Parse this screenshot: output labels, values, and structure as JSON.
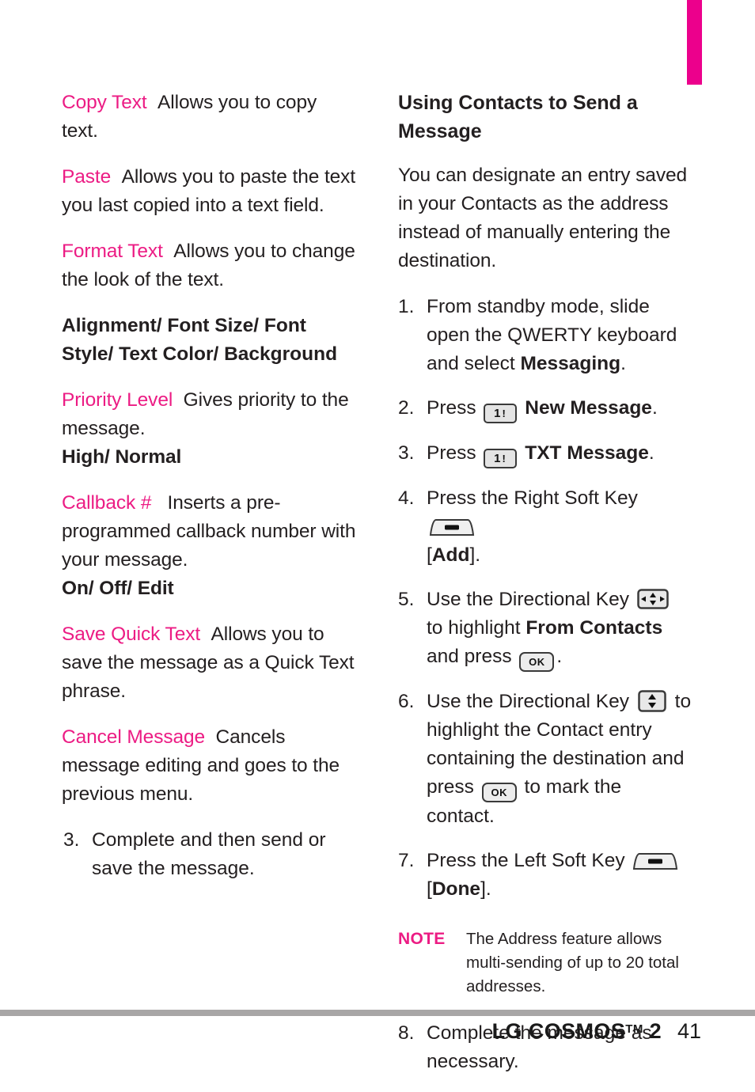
{
  "page": {
    "number": "41",
    "footer_brand": "LG COSMOS",
    "footer_tm": "TM",
    "footer_model": "2",
    "accent_color": "#EC1C84",
    "tab_color": "#EC008C"
  },
  "left_column": {
    "entries": [
      {
        "term": "Copy Text",
        "description": "Allows you to copy text."
      },
      {
        "term": "Paste",
        "description": "Allows you to paste the text you last copied into a text field."
      },
      {
        "term": "Format Text",
        "description": "Allows you to change the look of the text."
      }
    ],
    "format_options": "Alignment/ Font Size/ Font Style/ Text Color/ Background",
    "priority": {
      "term": "Priority Level",
      "description": "Gives priority to the message.",
      "options": "High/ Normal"
    },
    "callback": {
      "term": "Callback #",
      "description": "Inserts a pre-programmed callback number with your message.",
      "options": "On/ Off/ Edit"
    },
    "save_quick_text": {
      "term": "Save Quick Text",
      "description": "Allows you to save the message as a Quick Text phrase."
    },
    "cancel_message": {
      "term": "Cancel Message",
      "description": "Cancels message editing and goes to the previous menu."
    },
    "final_step": {
      "number": "3.",
      "text": "Complete and then send or save the message."
    }
  },
  "right_column": {
    "heading": "Using Contacts to Send a Message",
    "intro": "You can designate an entry saved in your Contacts as the address instead of manually entering the destination.",
    "steps": [
      {
        "number": "1.",
        "text_before": "From standby mode, slide open the QWERTY keyboard and select ",
        "bold": "Messaging",
        "text_after": "."
      },
      {
        "number": "2.",
        "text_before": "Press ",
        "key": "key-1-exclamation",
        "key_label": "1",
        "key_sublabel": "!",
        "bold": "New Message",
        "text_after": "."
      },
      {
        "number": "3.",
        "text_before": "Press ",
        "key": "key-1-exclamation",
        "key_label": "1",
        "key_sublabel": "!",
        "bold": "TXT Message",
        "text_after": "."
      },
      {
        "number": "4.",
        "text_before": "Press the Right Soft Key ",
        "key": "soft-key-icon",
        "text_mid": "[",
        "bold": "Add",
        "text_after": "]."
      },
      {
        "number": "5.",
        "text_before": "Use the Directional Key ",
        "key": "directional-key-4way-icon",
        "text_mid": " to highlight ",
        "bold": "From Contacts",
        "text_after": " and press ",
        "key2": "ok-key-icon",
        "key2_label": "OK",
        "text_end": "."
      },
      {
        "number": "6.",
        "text_before": "Use the Directional Key ",
        "key": "directional-key-updown-icon",
        "text_mid": " to highlight the Contact entry containing the destination and press ",
        "key2": "ok-key-icon",
        "key2_label": "OK",
        "text_end": " to mark the contact."
      },
      {
        "number": "7.",
        "text_before": "Press the Left Soft Key ",
        "key": "soft-key-icon",
        "text_mid": "[",
        "bold": "Done",
        "text_after": "]."
      },
      {
        "number": "8.",
        "text_before": "Complete the message as necessary."
      }
    ],
    "note": {
      "label": "NOTE",
      "text": "The Address feature allows multi-sending of up to 20 total addresses."
    }
  }
}
